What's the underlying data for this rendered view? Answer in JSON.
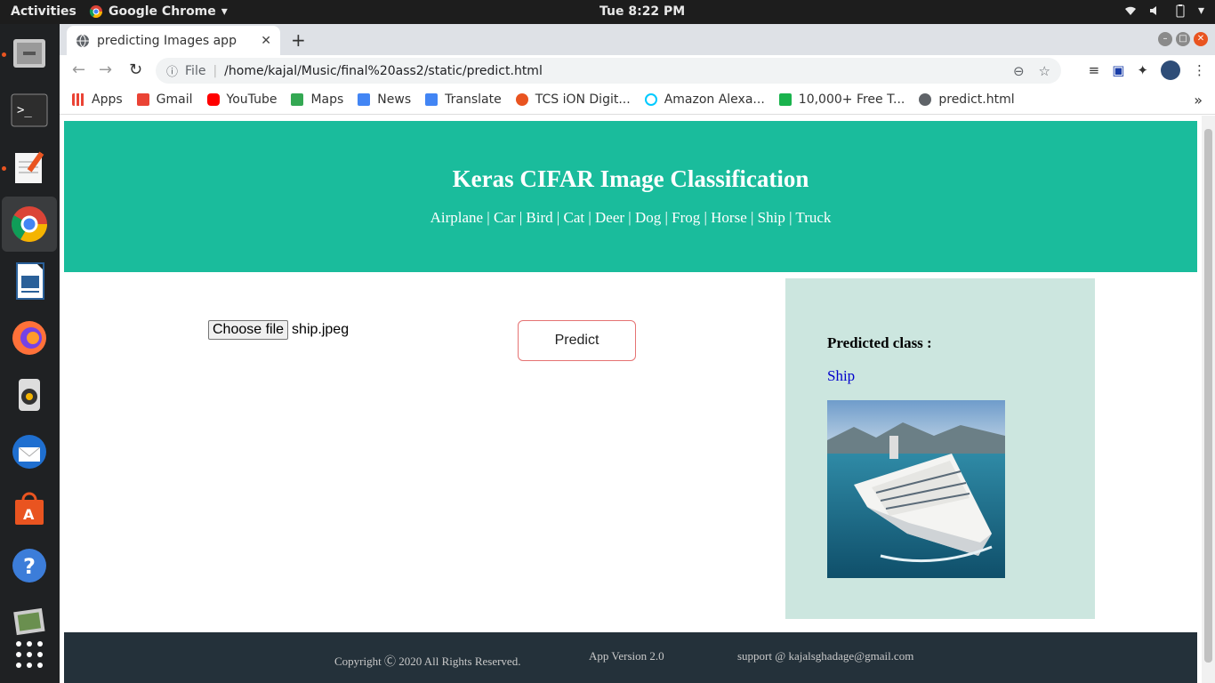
{
  "system": {
    "activities": "Activities",
    "app_menu": "Google Chrome",
    "clock": "Tue  8:22 PM"
  },
  "browser": {
    "tab_title": "predicting Images app",
    "omnibox_scheme": "File",
    "url": "/home/kajal/Music/final%20ass2/static/predict.html",
    "bookmarks": [
      {
        "label": "Apps",
        "color": "#4285f4"
      },
      {
        "label": "Gmail",
        "color": "#ea4335"
      },
      {
        "label": "YouTube",
        "color": "#ff0000"
      },
      {
        "label": "Maps",
        "color": "#34a853"
      },
      {
        "label": "News",
        "color": "#4285f4"
      },
      {
        "label": "Translate",
        "color": "#4285f4"
      },
      {
        "label": "TCS iON Digit...",
        "color": "#e95420"
      },
      {
        "label": "Amazon Alexa...",
        "color": "#00caff"
      },
      {
        "label": "10,000+ Free T...",
        "color": "#1ab34d"
      },
      {
        "label": "predict.html",
        "color": "#5f6368"
      }
    ]
  },
  "page": {
    "title": "Keras CIFAR Image Classification",
    "classes": "Airplane | Car | Bird | Cat | Deer | Dog | Frog | Horse | Ship | Truck",
    "choose_file": "Choose file",
    "file_name": "ship.jpeg",
    "predict_button": "Predict",
    "predicted_label": "Predicted class :",
    "predicted_value": "Ship",
    "footer_copyright": "Copyright Ⓒ 2020 All Rights Reserved.",
    "footer_version": "App Version 2.0",
    "footer_support": "support @ kajalsghadage@gmail.com"
  },
  "colors": {
    "header_bg": "#1abc9c",
    "result_bg": "#cce6df",
    "footer_bg": "#24313a",
    "predict_border": "#e57373"
  }
}
